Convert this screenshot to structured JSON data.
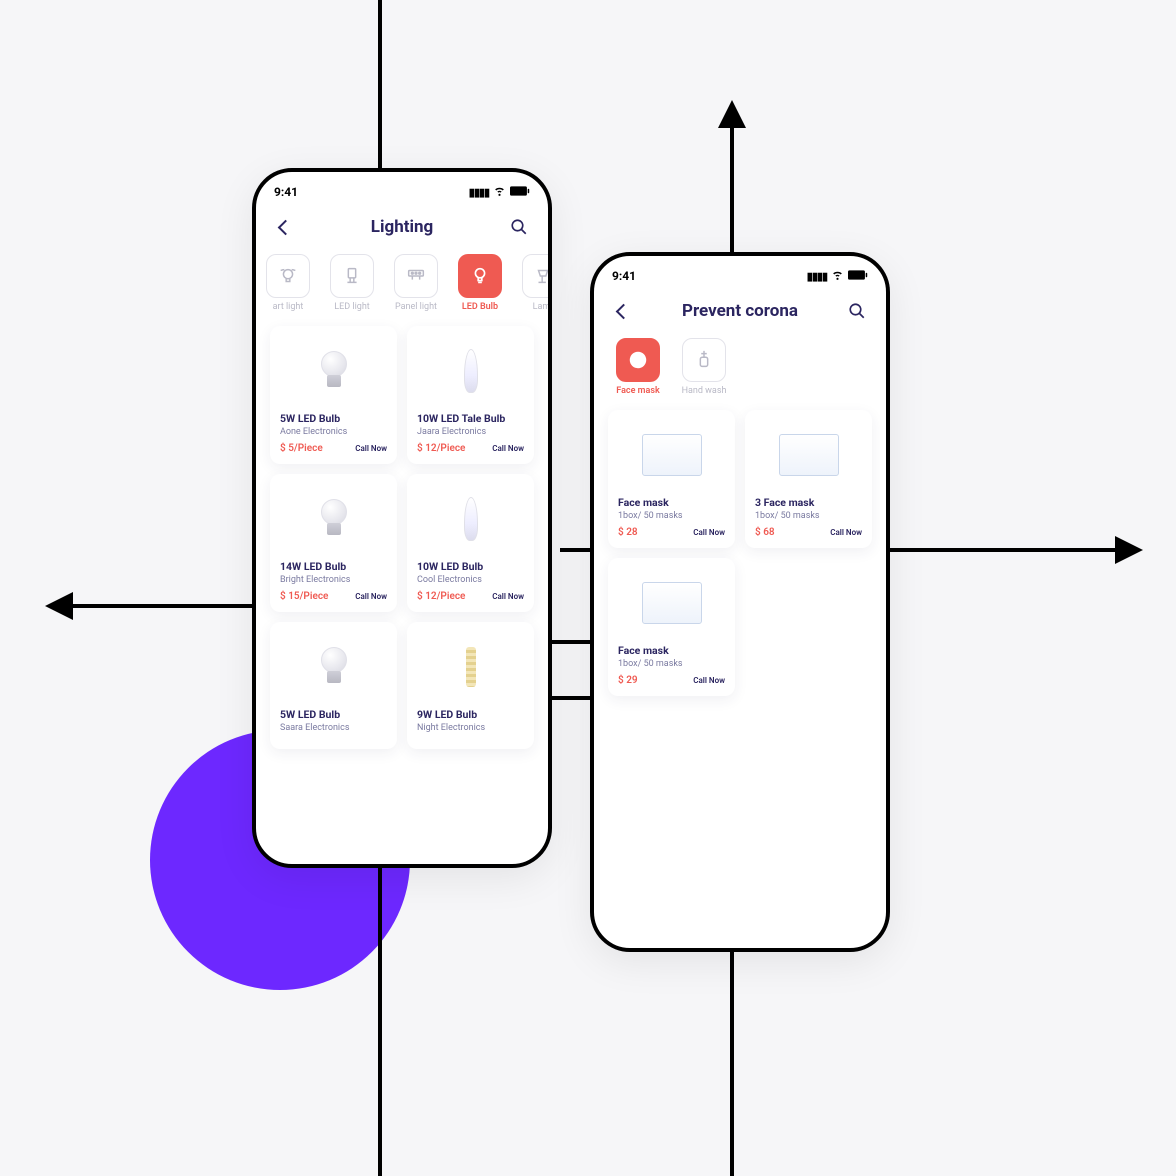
{
  "status_time": "9:41",
  "phone1": {
    "title": "Lighting",
    "categories": [
      {
        "label": "art light",
        "icon": "smart-light-icon",
        "active": false
      },
      {
        "label": "LED light",
        "icon": "led-light-icon",
        "active": false
      },
      {
        "label": "Panel light",
        "icon": "panel-light-icon",
        "active": false
      },
      {
        "label": "LED Bulb",
        "icon": "led-bulb-icon",
        "active": true
      },
      {
        "label": "Lamp",
        "icon": "lamp-icon",
        "active": false
      }
    ],
    "products": [
      {
        "title": "5W LED Bulb",
        "sub": "Aone Electronics",
        "price": "$ 5/Piece",
        "call": "Call Now",
        "img": "bulb"
      },
      {
        "title": "10W LED Tale Bulb",
        "sub": "Jaara Electronics",
        "price": "$ 12/Piece",
        "call": "Call Now",
        "img": "candle"
      },
      {
        "title": "14W LED Bulb",
        "sub": "Bright Electronics",
        "price": "$ 15/Piece",
        "call": "Call Now",
        "img": "bulb"
      },
      {
        "title": "10W LED Bulb",
        "sub": "Cool Electronics",
        "price": "$ 12/Piece",
        "call": "Call Now",
        "img": "candle"
      },
      {
        "title": "5W LED Bulb",
        "sub": "Saara Electronics",
        "price": "",
        "call": "",
        "img": "bulb"
      },
      {
        "title": "9W LED Bulb",
        "sub": "Night Electronics",
        "price": "",
        "call": "",
        "img": "tube"
      }
    ]
  },
  "phone2": {
    "title": "Prevent corona",
    "categories": [
      {
        "label": "Face mask",
        "icon": "face-mask-icon",
        "active": true
      },
      {
        "label": "Hand wash",
        "icon": "hand-wash-icon",
        "active": false
      }
    ],
    "products": [
      {
        "title": "Face mask",
        "sub": "1box/ 50 masks",
        "price": "$ 28",
        "call": "Call Now",
        "img": "box"
      },
      {
        "title": "3 Face mask",
        "sub": "1box/ 50 masks",
        "price": "$ 68",
        "call": "Call Now",
        "img": "boxmulti"
      },
      {
        "title": "Face mask",
        "sub": "1box/ 50 masks",
        "price": "$ 29",
        "call": "Call Now",
        "img": "box"
      }
    ]
  }
}
